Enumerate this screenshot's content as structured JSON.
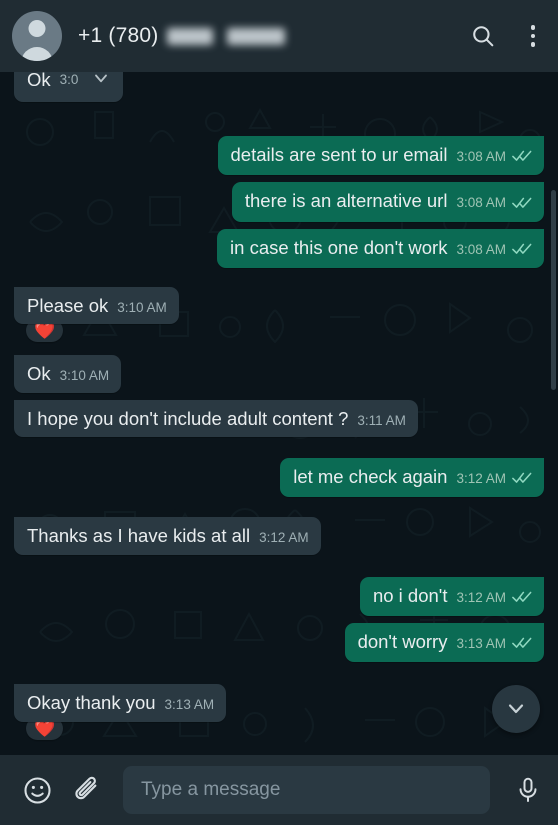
{
  "header": {
    "avatar_name": "contact-avatar",
    "phone_prefix": "+1 (780)",
    "redacted": true,
    "search_label": "Search",
    "menu_label": "More options"
  },
  "colors": {
    "background": "#0b141a",
    "header": "#202c33",
    "bubble_in": "#2a3942",
    "bubble_out": "#0b6b54",
    "text": "#e9edef",
    "time_in": "#9fb0b5",
    "time_out": "#9fc4b4",
    "tick_read": "#8fd8c0"
  },
  "messages": [
    {
      "id": 1,
      "dir": "in",
      "text": "Ok",
      "time": "3:0",
      "partial_top": true,
      "has_menu_chevron": true
    },
    {
      "id": 2,
      "dir": "out",
      "text": "details are sent to ur email",
      "time": "3:08 AM",
      "status": "read"
    },
    {
      "id": 3,
      "dir": "out",
      "text": "there is an alternative url",
      "time": "3:08 AM",
      "status": "read"
    },
    {
      "id": 4,
      "dir": "out",
      "text": "in case this one don't work",
      "time": "3:08 AM",
      "status": "read"
    },
    {
      "id": 5,
      "dir": "in",
      "text": "Please ok",
      "time": "3:10 AM",
      "reaction": "❤️"
    },
    {
      "id": 6,
      "dir": "in",
      "text": "Ok",
      "time": "3:10 AM"
    },
    {
      "id": 7,
      "dir": "in",
      "text": "I hope you don't include adult content ?",
      "time": "3:11 AM"
    },
    {
      "id": 8,
      "dir": "out",
      "text": "let me check again",
      "time": "3:12 AM",
      "status": "read"
    },
    {
      "id": 9,
      "dir": "in",
      "text": "Thanks as I have kids at all",
      "time": "3:12 AM"
    },
    {
      "id": 10,
      "dir": "out",
      "text": "no i don't",
      "time": "3:12 AM",
      "status": "read"
    },
    {
      "id": 11,
      "dir": "out",
      "text": "don't worry",
      "time": "3:13 AM",
      "status": "read"
    },
    {
      "id": 12,
      "dir": "in",
      "text": "Okay thank you",
      "time": "3:13 AM",
      "reaction": "❤️"
    },
    {
      "id": 13,
      "dir": "out",
      "text": "",
      "time": "",
      "partial_bottom": true
    }
  ],
  "scroll_button": {
    "name": "scroll-to-bottom",
    "icon": "chevron-down-icon"
  },
  "input_bar": {
    "emoji_label": "Emoji",
    "attach_label": "Attach",
    "placeholder": "Type a message",
    "value": "",
    "mic_label": "Voice message"
  }
}
